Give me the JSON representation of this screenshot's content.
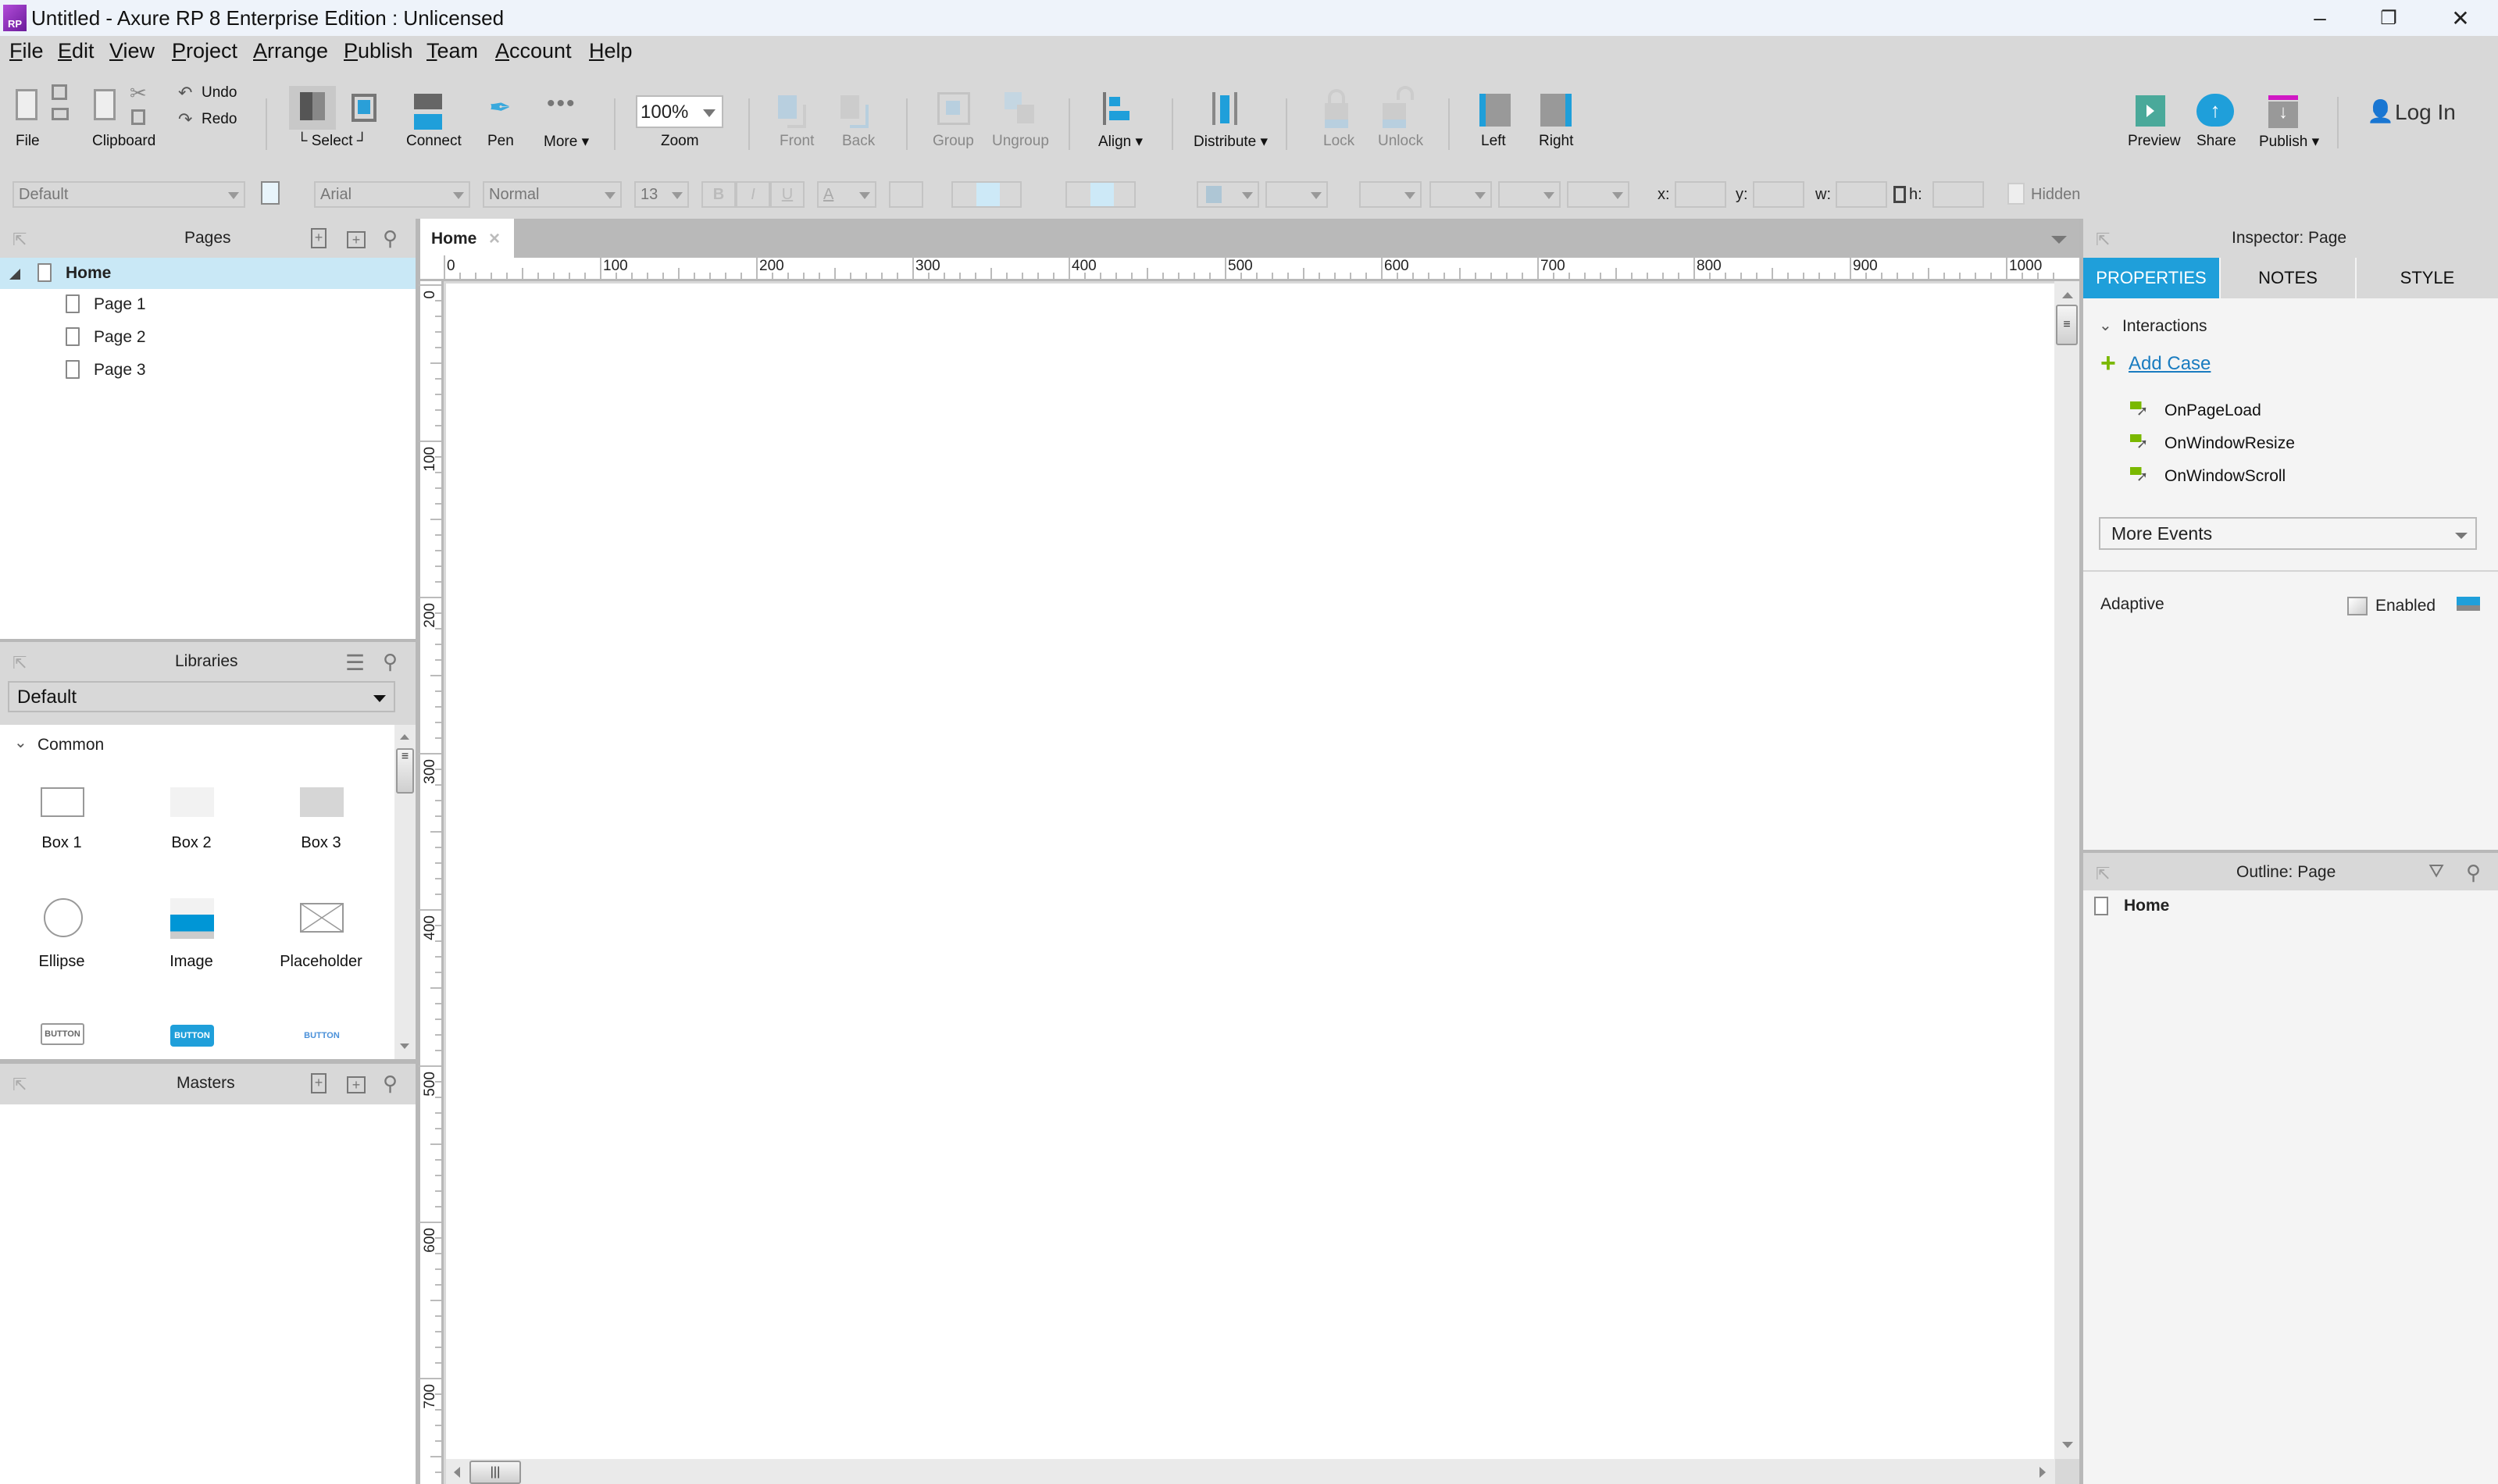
{
  "window": {
    "title": "Untitled - Axure RP 8 Enterprise Edition : Unlicensed",
    "logo_text": "RP",
    "controls": {
      "minimize": "–",
      "restore": "❐",
      "close": "✕"
    }
  },
  "menu": [
    "File",
    "Edit",
    "View",
    "Project",
    "Arrange",
    "Publish",
    "Team",
    "Account",
    "Help"
  ],
  "toolbar": {
    "file": "File",
    "clipboard": "Clipboard",
    "undo": "Undo",
    "redo": "Redo",
    "select": "Select",
    "connect": "Connect",
    "pen": "Pen",
    "more": "More ▾",
    "zoom_value": "100%",
    "zoom": "Zoom",
    "front": "Front",
    "back": "Back",
    "group": "Group",
    "ungroup": "Ungroup",
    "align": "Align ▾",
    "distribute": "Distribute ▾",
    "lock": "Lock",
    "unlock": "Unlock",
    "left": "Left",
    "right": "Right",
    "preview": "Preview",
    "share": "Share",
    "publish": "Publish ▾",
    "login": "Log In"
  },
  "format": {
    "style": "Default",
    "font": "Arial",
    "weight": "Normal",
    "size": "13",
    "bold": "B",
    "italic": "I",
    "underline": "U",
    "font_color": "A",
    "x_label": "x:",
    "y_label": "y:",
    "w_label": "w:",
    "h_label": "h:",
    "x": "",
    "y": "",
    "w": "",
    "h": "",
    "hidden": "Hidden"
  },
  "pages_panel": {
    "title": "Pages",
    "items": [
      {
        "label": "Home",
        "selected": true
      },
      {
        "label": "Page 1"
      },
      {
        "label": "Page 2"
      },
      {
        "label": "Page 3"
      }
    ]
  },
  "libraries_panel": {
    "title": "Libraries",
    "library": "Default",
    "section": "Common",
    "widgets": [
      "Box 1",
      "Box 2",
      "Box 3",
      "Ellipse",
      "Image",
      "Placeholder"
    ],
    "button_widgets": [
      "BUTTON",
      "BUTTON",
      "BUTTON"
    ]
  },
  "masters_panel": {
    "title": "Masters"
  },
  "canvas": {
    "tab": "Home",
    "tab_close": "×",
    "hruler": [
      "0",
      "100",
      "200",
      "300",
      "400",
      "500",
      "600",
      "700",
      "800",
      "900",
      "1000"
    ],
    "vruler": [
      "0",
      "100",
      "200",
      "300",
      "400",
      "500",
      "600",
      "700"
    ]
  },
  "inspector": {
    "title": "Inspector: Page",
    "tabs": [
      "PROPERTIES",
      "NOTES",
      "STYLE"
    ],
    "active_tab": "PROPERTIES",
    "interactions": "Interactions",
    "add_case": "Add Case",
    "events": [
      "OnPageLoad",
      "OnWindowResize",
      "OnWindowScroll"
    ],
    "more_events": "More Events",
    "adaptive": "Adaptive",
    "enabled": "Enabled",
    "enabled_checked": false
  },
  "outline": {
    "title": "Outline: Page",
    "items": [
      "Home"
    ]
  },
  "colors": {
    "accent": "#1f9fda",
    "selection": "#c9e8f6",
    "event_green": "#7ab800",
    "link": "#1a7cc0"
  }
}
